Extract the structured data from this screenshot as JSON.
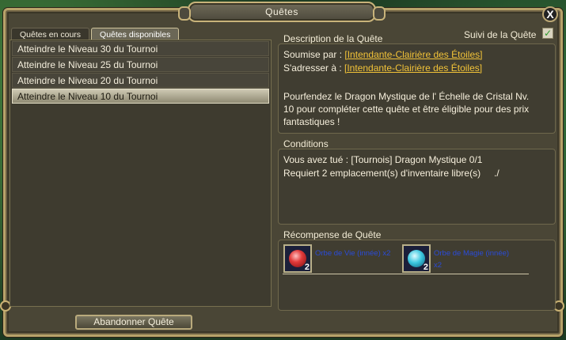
{
  "window": {
    "title": "Quêtes",
    "close_label": "X"
  },
  "tabs": [
    {
      "label": "Quêtes en cours",
      "active": false
    },
    {
      "label": "Quêtes disponibles",
      "active": true
    }
  ],
  "quests": [
    {
      "label": "Atteindre le Niveau 30 du Tournoi",
      "selected": false
    },
    {
      "label": "Atteindre le Niveau 25 du Tournoi",
      "selected": false
    },
    {
      "label": "Atteindre le Niveau 20 du Tournoi",
      "selected": false
    },
    {
      "label": "Atteindre le Niveau 10 du Tournoi",
      "selected": true
    }
  ],
  "abandon_button": "Abandonner Quête",
  "description": {
    "header": "Description de la Quête",
    "track_label": "Suivi de la Quête",
    "track_checked": true,
    "submitted_by_label": "Soumise par :",
    "submitted_by": "[Intendante-Clairière des Étoiles]",
    "address_to_label": "S'adresser à :",
    "address_to": "[Intendante-Clairière des Étoiles]",
    "text": "Pourfendez le Dragon Mystique de l' Échelle de Cristal Nv. 10 pour compléter cette quête et être éligible pour des prix fantastiques !"
  },
  "conditions": {
    "header": "Conditions",
    "line1": "Vous avez tué : [Tournois] Dragon Mystique 0/1",
    "line2": "Requiert 2 emplacement(s) d'inventaire libre(s)",
    "line2_mark": "./"
  },
  "rewards": {
    "header": "Récompense de Quête",
    "items": [
      {
        "name": "Orbe de Vie (innée) x2",
        "qty": "2",
        "icon": "red-orb-icon"
      },
      {
        "name": "Orbe de Magie (innée)",
        "name2": "x2",
        "qty": "2",
        "icon": "blue-orb-icon"
      }
    ]
  },
  "colors": {
    "link": "#f2c338",
    "reward_name": "#2a4bd8",
    "frame": "#b8a36a"
  }
}
